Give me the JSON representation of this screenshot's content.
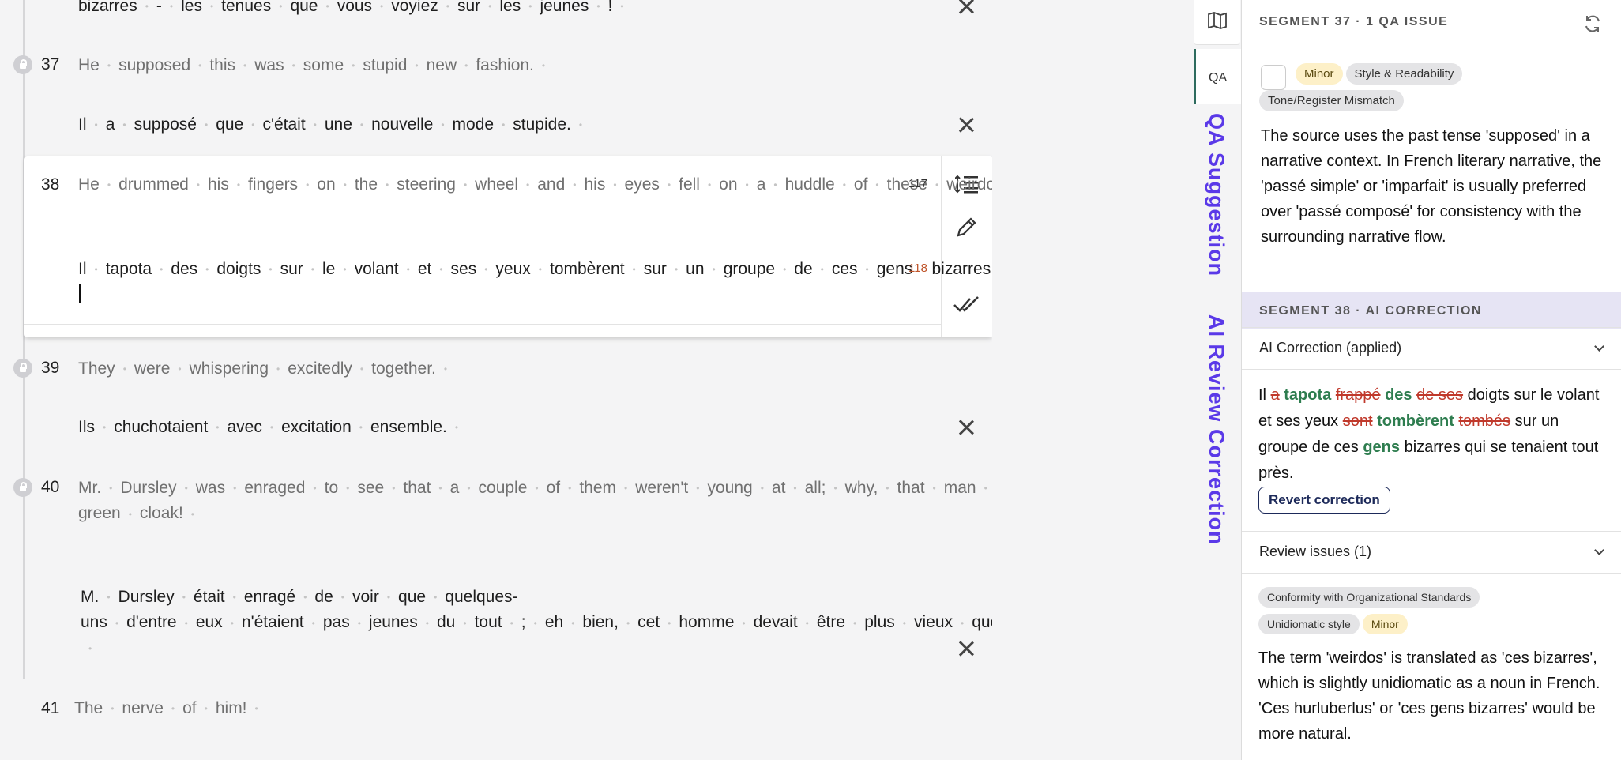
{
  "segments": {
    "s36": {
      "target_text": "bizarres - les tenues que vous voyiez sur les jeunes !"
    },
    "s37": {
      "num": "37",
      "source": "He supposed this was some stupid new fashion.",
      "target": "Il a supposé que c'était une nouvelle mode stupide.",
      "qa_label": "QA",
      "qa_count": "1"
    },
    "s38": {
      "num": "38",
      "source": "He drummed his fingers on the steering wheel and his eyes fell on a huddle of these weirdos standing quite close by.",
      "target": "Il tapota des doigts sur le volant et ses yeux tombèrent sur un groupe de ces gens bizarres qui se tenaient tout près.",
      "source_count": "117",
      "target_count": "118",
      "qa_label": "QA"
    },
    "s39": {
      "num": "39",
      "source": "They were whispering excitedly together.",
      "target": "Ils chuchotaient avec excitation ensemble.",
      "qa_label": "QA",
      "qa_count": "1"
    },
    "s40": {
      "num": "40",
      "source": "Mr. Dursley was enraged to see that a couple of them weren't young at all; why, that man had to be older than he was, and wearing an emerald-green cloak!",
      "target": "M. Dursley était enragé de voir que quelques-uns d'entre eux n'étaient pas jeunes du tout ; eh bien, cet homme devait être plus vieux que lui et porter une cape vert émeraude !",
      "qa_label": "QA"
    },
    "s41": {
      "num": "41",
      "source": "The nerve of him!",
      "qa_label": "QA"
    }
  },
  "sidebar_tabs": {
    "qa": "QA",
    "qa_suggestion": "QA Suggestion",
    "ai_review": "AI Review Correction"
  },
  "panel": {
    "qa_header": "SEGMENT 37 · 1 QA ISSUE",
    "qa_chips": [
      "Minor",
      "Style & Readability",
      "Tone/Register Mismatch"
    ],
    "qa_text": "The source uses the past tense 'supposed' in a narrative context. In French literary narrative, the 'passé simple' or 'imparfait' is usually preferred over 'passé composé' for consistency with the surrounding narrative flow.",
    "ai_header": "SEGMENT 38 · AI CORRECTION",
    "ai_accordion": "AI Correction (applied)",
    "correction": {
      "w_il": "Il",
      "d_a": "a",
      "i_tapota": "tapota",
      "d_frappe": "frappé",
      "i_des": "des",
      "d_deses": "de ses",
      "p1": "doigts sur le volant et ses yeux",
      "d_sont": "sont",
      "i_tomberent": "tombèrent",
      "d_tombes": "tombés",
      "p2": "sur un groupe de ces",
      "i_gens": "gens",
      "p3": "bizarres qui se tenaient tout près."
    },
    "revert_label": "Revert correction",
    "review_accordion": "Review issues (1)",
    "review_chips": [
      "Conformity with Organizational Standards",
      "Unidiomatic style",
      "Minor"
    ],
    "review_text": "The term 'weirdos' is translated as 'ces bizarres', which is slightly unidiomatic as a noun in French. 'Ces hurluberlus' or 'ces gens bizarres' would be more natural."
  },
  "colors": {
    "accent_purple": "#5a39e8",
    "ins_green": "#2e7d4f",
    "del_red": "#c0392b",
    "badge_red": "#9e1c1c",
    "badge_green": "#2e8b57"
  }
}
